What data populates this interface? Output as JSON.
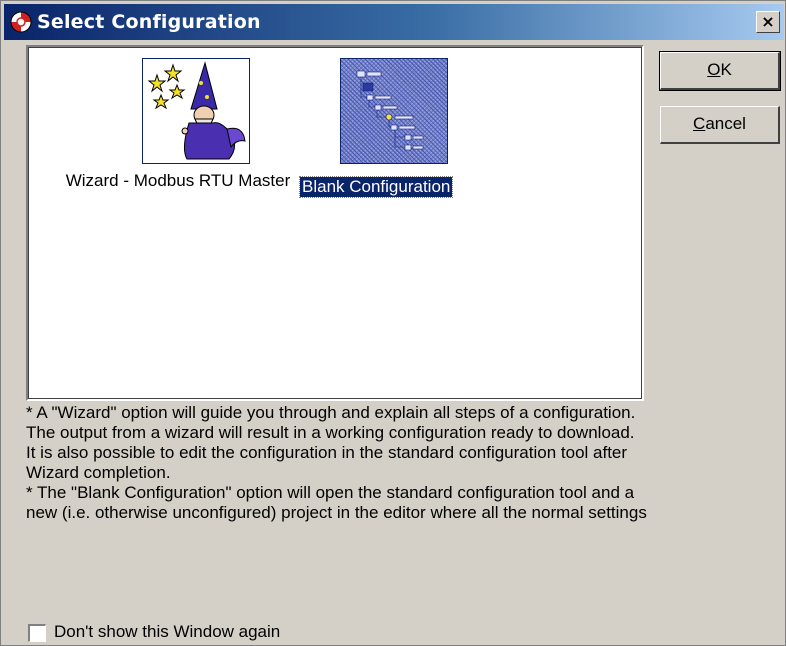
{
  "window": {
    "title": "Select Configuration",
    "close_glyph": "×"
  },
  "icons": {
    "app": "configuration-app-icon",
    "wizard": "wizard-icon",
    "blank": "blank-configuration-icon"
  },
  "items": [
    {
      "label": "Wizard - Modbus RTU Master",
      "selected": false
    },
    {
      "label": "Blank Configuration",
      "selected": true
    }
  ],
  "buttons": {
    "ok": {
      "pre": "",
      "accel": "O",
      "post": "K"
    },
    "cancel": {
      "pre": "",
      "accel": "C",
      "post": "ancel"
    }
  },
  "description": [
    "* A \"Wizard\" option will guide you through and explain all steps of a configuration.",
    "The output from a wizard will result in a working configuration ready to download.",
    "It is also possible to edit the configuration in the standard configuration tool after",
    "Wizard completion.",
    "* The \"Blank Configuration\" option will open the standard configuration tool and a",
    "new (i.e. otherwise unconfigured) project in the editor where all the normal settings"
  ],
  "checkbox": {
    "label": "Don't show this Window again",
    "checked": false
  },
  "colors": {
    "selection": "#0a246a",
    "face": "#d4d0c8",
    "title_start": "#0a246a",
    "title_end": "#a6caf0"
  }
}
